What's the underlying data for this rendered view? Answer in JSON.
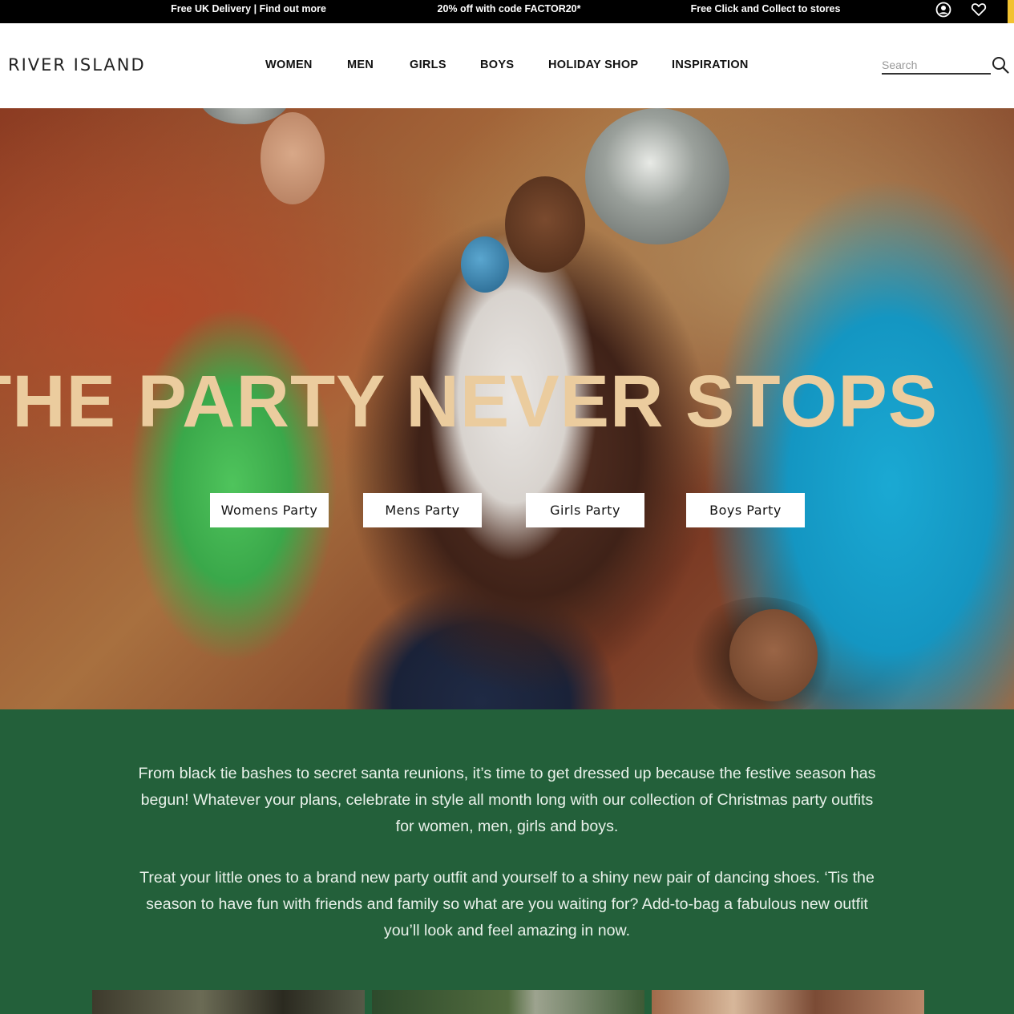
{
  "promo_bar": {
    "message_1": "Free UK Delivery | Find out more",
    "message_2": "20% off with code FACTOR20*",
    "message_3": "Free Click and Collect to stores",
    "account_icon": "user-circle-icon",
    "wishlist_icon": "heart-icon",
    "accent_color": "#f2c230"
  },
  "header": {
    "logo": "RIVER ISLAND",
    "nav": [
      "WOMEN",
      "MEN",
      "GIRLS",
      "BOYS",
      "HOLIDAY SHOP",
      "INSPIRATION"
    ],
    "search": {
      "placeholder": "Search",
      "value": "",
      "icon": "search-icon"
    }
  },
  "hero": {
    "headline": "THE PARTY NEVER STOPS",
    "headline_color": "#ebcc9e",
    "buttons": [
      "Womens Party",
      "Mens Party",
      "Girls Party",
      "Boys Party"
    ]
  },
  "intro": {
    "background_color": "#23603a",
    "paragraph_1": "From black tie bashes to secret santa reunions, it’s time to get dressed up because the festive season has begun! Whatever your plans, celebrate in style all month long with our collection of Christmas party outfits for women, men, girls and boys.",
    "paragraph_2": "Treat your little ones to a brand new party outfit and yourself to a shiny new pair of dancing shoes. ‘Tis the season to have fun with friends and family so what are you waiting for? Add-to-bag a fabulous new outfit you’ll look and feel amazing in now."
  }
}
